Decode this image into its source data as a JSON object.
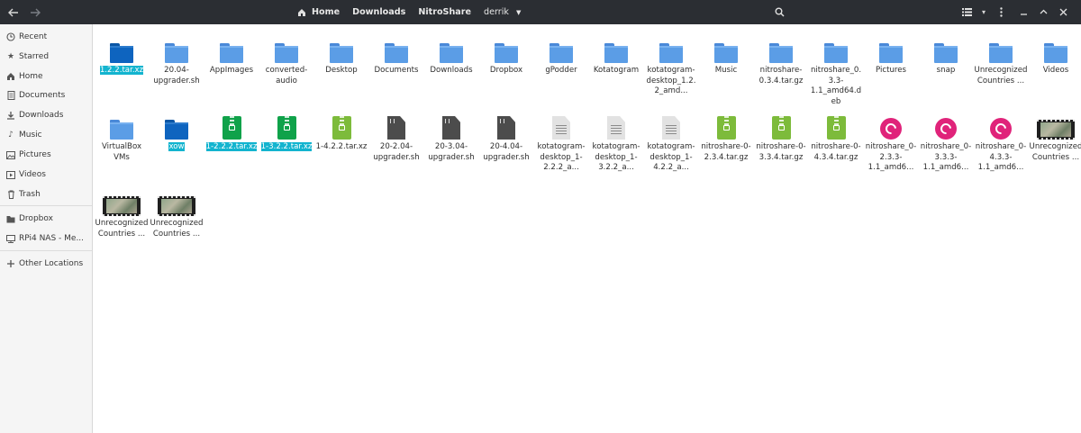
{
  "header": {
    "breadcrumbs": [
      "Home",
      "Downloads",
      "NitroShare",
      "derrik"
    ]
  },
  "sidebar": {
    "items": [
      {
        "label": "Recent",
        "icon": "clock-icon"
      },
      {
        "label": "Starred",
        "icon": "star-icon"
      },
      {
        "label": "Home",
        "icon": "home-icon"
      },
      {
        "label": "Documents",
        "icon": "document-icon"
      },
      {
        "label": "Downloads",
        "icon": "download-icon"
      },
      {
        "label": "Music",
        "icon": "music-icon"
      },
      {
        "label": "Pictures",
        "icon": "picture-icon"
      },
      {
        "label": "Videos",
        "icon": "video-icon"
      },
      {
        "label": "Trash",
        "icon": "trash-icon"
      },
      {
        "label": "Dropbox",
        "icon": "folder-icon"
      },
      {
        "label": "RPi4 NAS - Me...",
        "icon": "network-drive-icon"
      },
      {
        "label": "Other Locations",
        "icon": "plus-icon"
      }
    ]
  },
  "files": [
    {
      "name": "1.2.2.tar.xz",
      "type": "folder",
      "selected": true
    },
    {
      "name": "20.04-upgrader.sh",
      "type": "folder"
    },
    {
      "name": "AppImages",
      "type": "folder"
    },
    {
      "name": "converted-audio",
      "type": "folder"
    },
    {
      "name": "Desktop",
      "type": "folder"
    },
    {
      "name": "Documents",
      "type": "folder"
    },
    {
      "name": "Downloads",
      "type": "folder"
    },
    {
      "name": "Dropbox",
      "type": "folder"
    },
    {
      "name": "gPodder",
      "type": "folder"
    },
    {
      "name": "Kotatogram",
      "type": "folder"
    },
    {
      "name": "kotatogram-desktop_1.2.2_amd...",
      "type": "folder"
    },
    {
      "name": "Music",
      "type": "folder"
    },
    {
      "name": "nitroshare-0.3.4.tar.gz",
      "type": "folder"
    },
    {
      "name": "nitroshare_0.3.3-1.1_amd64.deb",
      "type": "folder"
    },
    {
      "name": "Pictures",
      "type": "folder"
    },
    {
      "name": "snap",
      "type": "folder"
    },
    {
      "name": "Unrecognized Countries ...",
      "type": "folder"
    },
    {
      "name": "Videos",
      "type": "folder"
    },
    {
      "name": "VirtualBox VMs",
      "type": "folder"
    },
    {
      "name": "xow",
      "type": "folder",
      "selected": true
    },
    {
      "name": "1-2.2.2.tar.xz",
      "type": "archive",
      "selected": true
    },
    {
      "name": "1-3.2.2.tar.xz",
      "type": "archive",
      "selected": true
    },
    {
      "name": "1-4.2.2.tar.xz",
      "type": "archive"
    },
    {
      "name": "20-2.04-upgrader.sh",
      "type": "script"
    },
    {
      "name": "20-3.04-upgrader.sh",
      "type": "script"
    },
    {
      "name": "20-4.04-upgrader.sh",
      "type": "script"
    },
    {
      "name": "kotatogram-desktop_1-2.2.2_a...",
      "type": "doc"
    },
    {
      "name": "kotatogram-desktop_1-3.2.2_a...",
      "type": "doc"
    },
    {
      "name": "kotatogram-desktop_1-4.2.2_a...",
      "type": "doc"
    },
    {
      "name": "nitroshare-0-2.3.4.tar.gz",
      "type": "archive"
    },
    {
      "name": "nitroshare-0-3.3.4.tar.gz",
      "type": "archive"
    },
    {
      "name": "nitroshare-0-4.3.4.tar.gz",
      "type": "archive"
    },
    {
      "name": "nitroshare_0-2.3.3-1.1_amd6...",
      "type": "deb"
    },
    {
      "name": "nitroshare_0-3.3.3-1.1_amd6...",
      "type": "deb"
    },
    {
      "name": "nitroshare_0-4.3.3-1.1_amd6...",
      "type": "deb"
    },
    {
      "name": "Unrecognized Countries ...",
      "type": "video"
    },
    {
      "name": "Unrecognized Countries ...",
      "type": "video"
    },
    {
      "name": "Unrecognized Countries ...",
      "type": "video"
    }
  ],
  "colors": {
    "headerbar": "#2b2e33",
    "selection": "#13b4cf",
    "folder": "#5b9de6",
    "archive": "#7dbb3b",
    "debian": "#e0237a"
  }
}
